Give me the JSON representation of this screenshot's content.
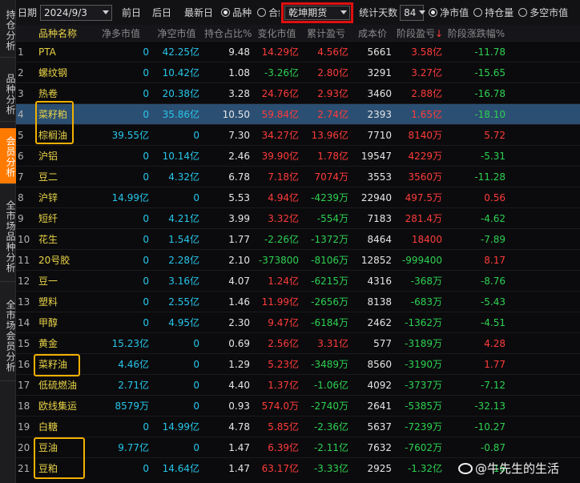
{
  "sidebar": {
    "tabs": [
      {
        "label": "持仓分析",
        "active": false
      },
      {
        "label": "品种分析",
        "active": false
      },
      {
        "label": "会员分析",
        "active": true
      },
      {
        "label": "全市场品种分析",
        "active": false
      },
      {
        "label": "全市场会员分析",
        "active": false
      }
    ]
  },
  "toolbar": {
    "date_label": "日期",
    "date_value": "2024/9/3",
    "prev_day": "前日",
    "next_day": "后日",
    "latest_day": "最新日",
    "radio_variety": "品种",
    "radio_contract": "合约",
    "member_value": "乾坤期货",
    "stat_days_label": "统计天数",
    "stat_days_value": "84",
    "radio_net_value": "净市值",
    "radio_holding": "持仓量",
    "radio_long_short": "多空市值"
  },
  "table": {
    "headers": [
      "品种名称",
      "净多市值",
      "净空市值",
      "持仓占比%",
      "变化市值",
      "累计盈亏",
      "成本价",
      "阶段盈亏",
      "阶段涨跌幅%"
    ],
    "sort_arrow": "↓",
    "rows": [
      {
        "idx": "1",
        "name": "PTA",
        "long": "0",
        "short": "42.25亿",
        "pct": "9.48",
        "chg": "14.29亿",
        "cum": "4.56亿",
        "cost": "5661",
        "stage": "3.58亿",
        "rise": "-11.78",
        "chgc": "red",
        "cumc": "red",
        "stagec": "red",
        "risec": "green"
      },
      {
        "idx": "2",
        "name": "螺纹钢",
        "long": "0",
        "short": "10.42亿",
        "pct": "1.08",
        "chg": "-3.26亿",
        "cum": "2.80亿",
        "cost": "3291",
        "stage": "3.27亿",
        "rise": "-15.65",
        "chgc": "green",
        "cumc": "red",
        "stagec": "red",
        "risec": "green"
      },
      {
        "idx": "3",
        "name": "热卷",
        "long": "0",
        "short": "20.38亿",
        "pct": "3.28",
        "chg": "24.76亿",
        "cum": "2.93亿",
        "cost": "3460",
        "stage": "2.88亿",
        "rise": "-16.78",
        "chgc": "red",
        "cumc": "red",
        "stagec": "red",
        "risec": "green"
      },
      {
        "idx": "4",
        "name": "菜籽粕",
        "long": "0",
        "short": "35.86亿",
        "pct": "10.50",
        "chg": "59.84亿",
        "cum": "2.74亿",
        "cost": "2393",
        "stage": "1.65亿",
        "rise": "-18.10",
        "chgc": "red",
        "cumc": "red",
        "stagec": "red",
        "risec": "green"
      },
      {
        "idx": "5",
        "name": "棕榈油",
        "long": "39.55亿",
        "short": "0",
        "pct": "7.30",
        "chg": "34.27亿",
        "cum": "13.96亿",
        "cost": "7710",
        "stage": "8140万",
        "rise": "5.72",
        "chgc": "red",
        "cumc": "red",
        "stagec": "red",
        "risec": "red"
      },
      {
        "idx": "6",
        "name": "沪铝",
        "long": "0",
        "short": "10.14亿",
        "pct": "2.46",
        "chg": "39.90亿",
        "cum": "1.78亿",
        "cost": "19547",
        "stage": "4229万",
        "rise": "-5.31",
        "chgc": "red",
        "cumc": "red",
        "stagec": "red",
        "risec": "green"
      },
      {
        "idx": "7",
        "name": "豆二",
        "long": "0",
        "short": "4.32亿",
        "pct": "6.78",
        "chg": "7.18亿",
        "cum": "7074万",
        "cost": "3553",
        "stage": "3560万",
        "rise": "-11.28",
        "chgc": "red",
        "cumc": "red",
        "stagec": "red",
        "risec": "green"
      },
      {
        "idx": "8",
        "name": "沪锌",
        "long": "14.99亿",
        "short": "0",
        "pct": "5.53",
        "chg": "4.94亿",
        "cum": "-4239万",
        "cost": "22940",
        "stage": "497.5万",
        "rise": "0.56",
        "chgc": "red",
        "cumc": "green",
        "stagec": "red",
        "risec": "red"
      },
      {
        "idx": "9",
        "name": "短纤",
        "long": "0",
        "short": "4.21亿",
        "pct": "3.99",
        "chg": "3.32亿",
        "cum": "-554万",
        "cost": "7183",
        "stage": "281.4万",
        "rise": "-4.62",
        "chgc": "red",
        "cumc": "green",
        "stagec": "red",
        "risec": "green"
      },
      {
        "idx": "10",
        "name": "花生",
        "long": "0",
        "short": "1.54亿",
        "pct": "1.77",
        "chg": "-2.26亿",
        "cum": "-1372万",
        "cost": "8464",
        "stage": "18400",
        "rise": "-7.89",
        "chgc": "green",
        "cumc": "green",
        "stagec": "red",
        "risec": "green"
      },
      {
        "idx": "11",
        "name": "20号胶",
        "long": "0",
        "short": "2.28亿",
        "pct": "2.10",
        "chg": "-373800",
        "cum": "-8106万",
        "cost": "12852",
        "stage": "-999400",
        "rise": "8.17",
        "chgc": "green",
        "cumc": "green",
        "stagec": "green",
        "risec": "red"
      },
      {
        "idx": "12",
        "name": "豆一",
        "long": "0",
        "short": "3.16亿",
        "pct": "4.07",
        "chg": "1.24亿",
        "cum": "-6215万",
        "cost": "4316",
        "stage": "-368万",
        "rise": "-8.76",
        "chgc": "red",
        "cumc": "green",
        "stagec": "green",
        "risec": "green"
      },
      {
        "idx": "13",
        "name": "塑料",
        "long": "0",
        "short": "2.55亿",
        "pct": "1.46",
        "chg": "11.99亿",
        "cum": "-2656万",
        "cost": "8138",
        "stage": "-683万",
        "rise": "-5.43",
        "chgc": "red",
        "cumc": "green",
        "stagec": "green",
        "risec": "green"
      },
      {
        "idx": "14",
        "name": "甲醇",
        "long": "0",
        "short": "4.95亿",
        "pct": "2.30",
        "chg": "9.47亿",
        "cum": "-6184万",
        "cost": "2462",
        "stage": "-1362万",
        "rise": "-4.51",
        "chgc": "red",
        "cumc": "green",
        "stagec": "green",
        "risec": "green"
      },
      {
        "idx": "15",
        "name": "黄金",
        "long": "15.23亿",
        "short": "0",
        "pct": "0.69",
        "chg": "2.56亿",
        "cum": "3.31亿",
        "cost": "577",
        "stage": "-3189万",
        "rise": "4.28",
        "chgc": "red",
        "cumc": "red",
        "stagec": "green",
        "risec": "red"
      },
      {
        "idx": "16",
        "name": "菜籽油",
        "long": "4.46亿",
        "short": "0",
        "pct": "1.29",
        "chg": "5.23亿",
        "cum": "-3489万",
        "cost": "8560",
        "stage": "-3190万",
        "rise": "1.77",
        "chgc": "red",
        "cumc": "green",
        "stagec": "green",
        "risec": "red"
      },
      {
        "idx": "17",
        "name": "低硫燃油",
        "long": "2.71亿",
        "short": "0",
        "pct": "4.40",
        "chg": "1.37亿",
        "cum": "-1.06亿",
        "cost": "4092",
        "stage": "-3737万",
        "rise": "-7.12",
        "chgc": "red",
        "cumc": "green",
        "stagec": "green",
        "risec": "green"
      },
      {
        "idx": "18",
        "name": "欧线集运",
        "long": "8579万",
        "short": "0",
        "pct": "0.93",
        "chg": "574.0万",
        "cum": "-2740万",
        "cost": "2641",
        "stage": "-5385万",
        "rise": "-32.13",
        "chgc": "red",
        "cumc": "green",
        "stagec": "green",
        "risec": "green"
      },
      {
        "idx": "19",
        "name": "白糖",
        "long": "0",
        "short": "14.99亿",
        "pct": "4.78",
        "chg": "5.85亿",
        "cum": "-2.36亿",
        "cost": "5637",
        "stage": "-7239万",
        "rise": "-10.27",
        "chgc": "red",
        "cumc": "green",
        "stagec": "green",
        "risec": "green"
      },
      {
        "idx": "20",
        "name": "豆油",
        "long": "9.77亿",
        "short": "0",
        "pct": "1.47",
        "chg": "6.39亿",
        "cum": "-2.11亿",
        "cost": "7632",
        "stage": "-7602万",
        "rise": "-0.87",
        "chgc": "red",
        "cumc": "green",
        "stagec": "green",
        "risec": "green"
      },
      {
        "idx": "21",
        "name": "豆粕",
        "long": "0",
        "short": "14.64亿",
        "pct": "1.47",
        "chg": "63.17亿",
        "cum": "-3.33亿",
        "cost": "2925",
        "stage": "-1.32亿",
        "rise": "-16",
        "chgc": "red",
        "cumc": "green",
        "stagec": "green",
        "risec": "green"
      }
    ]
  },
  "watermark": {
    "text": "@牛先生的生活",
    "icon": "weibo-icon"
  },
  "colors": {
    "positive": "#ff3b3b",
    "negative": "#2ed152",
    "accent": "#ff7a00",
    "highlight_box": "#f2b000",
    "red_box": "#e01010"
  }
}
